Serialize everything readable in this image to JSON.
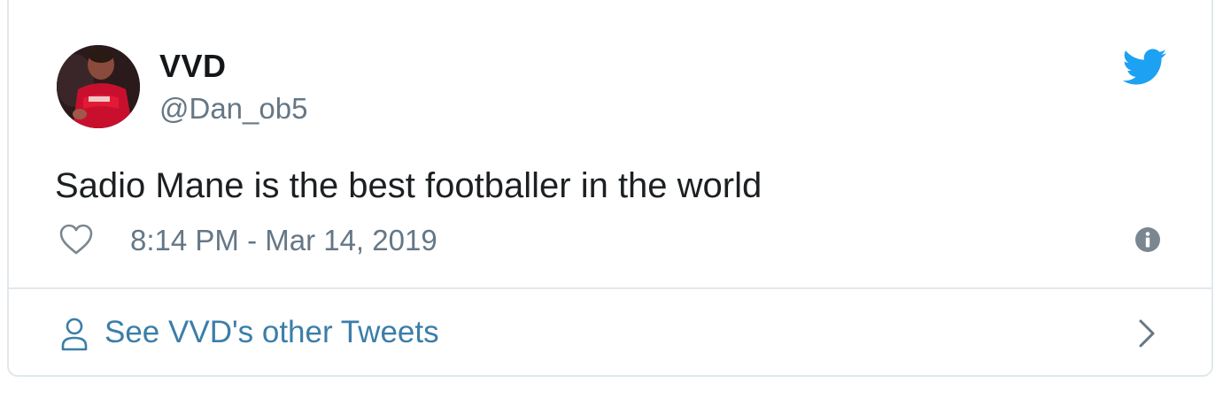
{
  "tweet": {
    "author": {
      "display_name": "VVD",
      "handle": "@Dan_ob5",
      "avatar_icon": "profile-photo"
    },
    "text": "Sadio Mane is the best footballer in the world",
    "timestamp": "8:14 PM - Mar 14, 2019",
    "icons": {
      "brand": "twitter-bird-icon",
      "like": "heart-icon",
      "info": "info-icon"
    },
    "footer": {
      "label": "See VVD's other Tweets",
      "icon": "person-icon",
      "arrow": "chevron-right-icon"
    }
  },
  "colors": {
    "brand_blue": "#1da1f2",
    "link_blue": "#3b7ea8",
    "text_primary": "#1c2022",
    "text_secondary": "#657786",
    "border": "#e1e8ed"
  }
}
